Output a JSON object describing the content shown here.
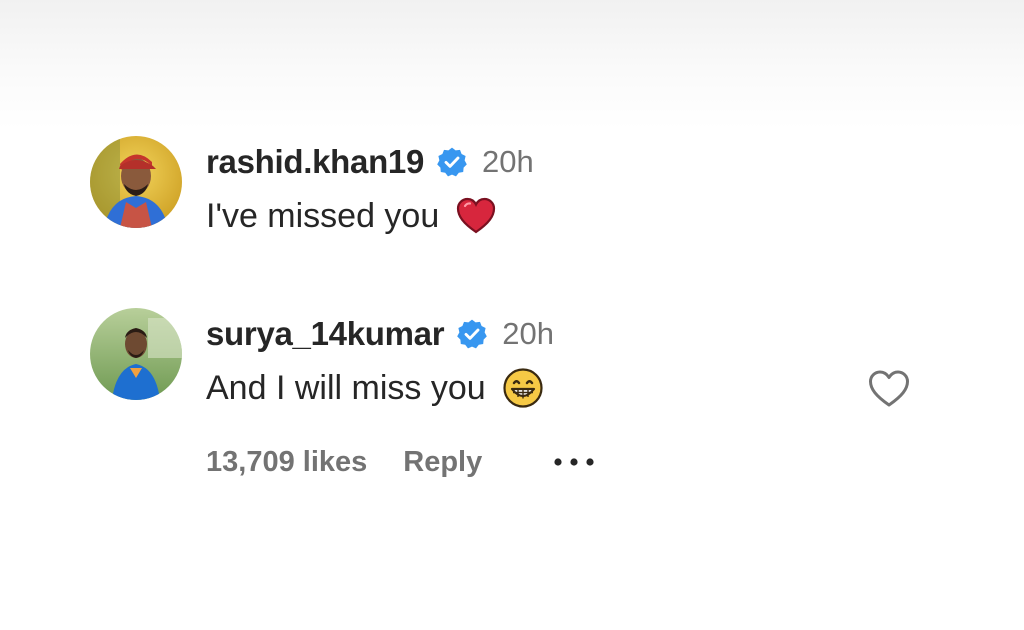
{
  "comments": [
    {
      "username": "rashid.khan19",
      "verified": true,
      "time": "20h",
      "text": "I've missed you",
      "emoji": "red-heart",
      "avatar": {
        "jersey_color": "#2f6fd6",
        "background": "#e8c33a"
      }
    },
    {
      "username": "surya_14kumar",
      "verified": true,
      "time": "20h",
      "text": "And I will miss you",
      "emoji": "grinning-face",
      "avatar": {
        "jersey_color": "#1e6fd0",
        "background": "#8fb870"
      },
      "likes": "13,709 likes",
      "reply_label": "Reply"
    }
  ],
  "colors": {
    "verified_blue": "#3897f0",
    "text_primary": "#262626",
    "text_secondary": "#737373",
    "heart_red": "#d7263d"
  },
  "icons": [
    "verified-icon",
    "heart-icon",
    "grin-emoji-icon",
    "like-heart-outline-icon",
    "more-options-icon"
  ]
}
